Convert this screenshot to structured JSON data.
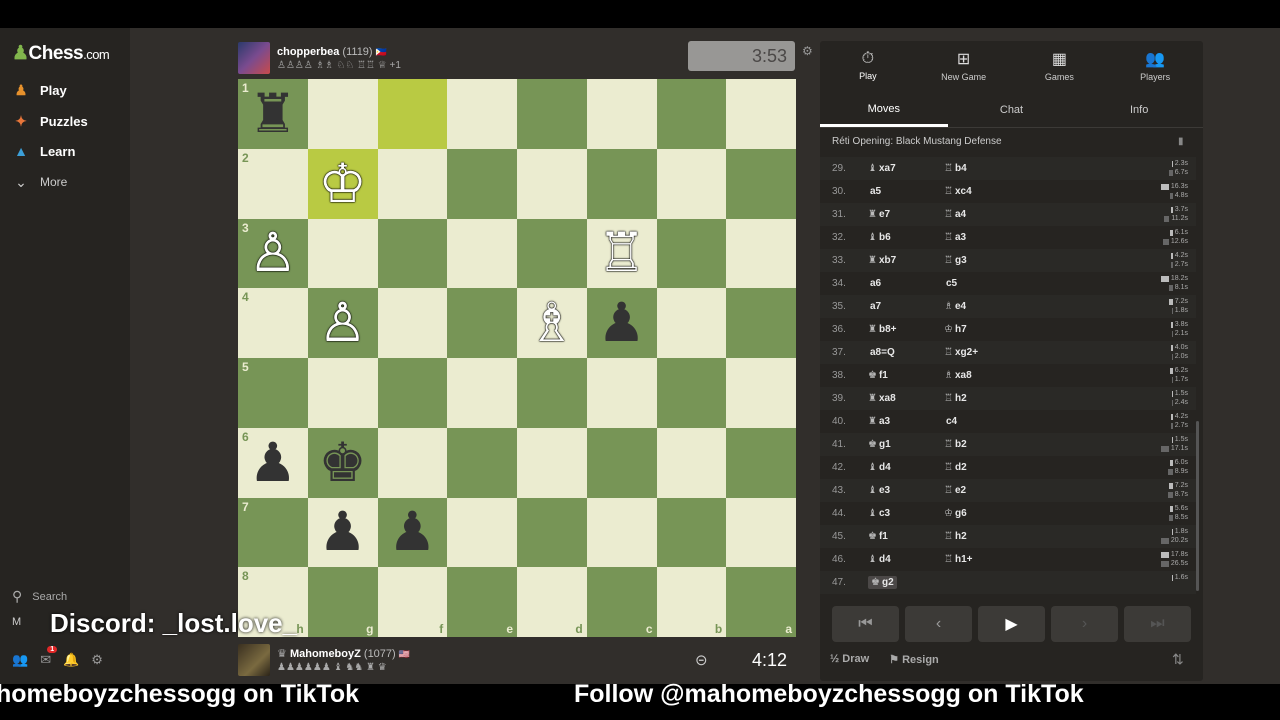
{
  "sidebar": {
    "logo": "Chess",
    "logo_suffix": ".com",
    "items": [
      {
        "label": "Play",
        "icon": "play-pawn-icon"
      },
      {
        "label": "Puzzles",
        "icon": "puzzle-icon"
      },
      {
        "label": "Learn",
        "icon": "learn-cap-icon"
      },
      {
        "label": "More",
        "icon": "chevron-down-icon"
      }
    ],
    "search_label": "Search",
    "user_label": "M",
    "notification_count": "1"
  },
  "top_player": {
    "name": "chopperbea",
    "rating": "(1119)",
    "captured": "♙♙♙♙ ♗♗ ♘♘ ♖♖ ♕",
    "advantage": "+1",
    "clock": "3:53"
  },
  "bottom_player": {
    "name": "MahomeboyZ",
    "rating": "(1077)",
    "captured": "♟♟♟♟♟♟ ♝ ♞♞ ♜ ♛",
    "clock": "4:12"
  },
  "board": {
    "ranks": [
      "1",
      "2",
      "3",
      "4",
      "5",
      "6",
      "7",
      "8"
    ],
    "files": [
      "h",
      "g",
      "f",
      "e",
      "d",
      "c",
      "b",
      "a"
    ],
    "pieces": [
      {
        "sq": "h1",
        "glyph": "♜",
        "color": "b"
      },
      {
        "sq": "g2",
        "glyph": "♔",
        "color": "w"
      },
      {
        "sq": "h3",
        "glyph": "♙",
        "color": "w"
      },
      {
        "sq": "c3",
        "glyph": "♖",
        "color": "w"
      },
      {
        "sq": "g4",
        "glyph": "♙",
        "color": "w"
      },
      {
        "sq": "d4",
        "glyph": "♗",
        "color": "w"
      },
      {
        "sq": "c4",
        "glyph": "♟",
        "color": "b"
      },
      {
        "sq": "h6",
        "glyph": "♟",
        "color": "b"
      },
      {
        "sq": "g6",
        "glyph": "♚",
        "color": "b"
      },
      {
        "sq": "g7",
        "glyph": "♟",
        "color": "b"
      },
      {
        "sq": "f7",
        "glyph": "♟",
        "color": "b"
      }
    ],
    "highlight": [
      "f1",
      "g2"
    ],
    "light_color": "#ebecd0",
    "dark_color": "#779556"
  },
  "panel": {
    "tabs": [
      {
        "label": "Play",
        "icon": "stopwatch-icon"
      },
      {
        "label": "New Game",
        "icon": "plus-icon"
      },
      {
        "label": "Games",
        "icon": "board-grid-icon"
      },
      {
        "label": "Players",
        "icon": "players-icon"
      }
    ],
    "subtabs": [
      "Moves",
      "Chat",
      "Info"
    ],
    "opening": "Réti Opening: Black Mustang Defense",
    "moves": [
      {
        "n": "29.",
        "w": "xa7",
        "wp": "♝",
        "b": "b4",
        "bp": "♖",
        "tw": "2.3s",
        "tb": "6.7s"
      },
      {
        "n": "30.",
        "w": "a5",
        "wp": "",
        "b": "xc4",
        "bp": "♖",
        "tw": "16.3s",
        "tb": "4.8s"
      },
      {
        "n": "31.",
        "w": "e7",
        "wp": "♜",
        "b": "a4",
        "bp": "♖",
        "tw": "3.7s",
        "tb": "11.2s"
      },
      {
        "n": "32.",
        "w": "b6",
        "wp": "♝",
        "b": "a3",
        "bp": "♖",
        "tw": "6.1s",
        "tb": "12.6s"
      },
      {
        "n": "33.",
        "w": "xb7",
        "wp": "♜",
        "b": "g3",
        "bp": "♖",
        "tw": "4.2s",
        "tb": "2.7s"
      },
      {
        "n": "34.",
        "w": "a6",
        "wp": "",
        "b": "c5",
        "bp": "",
        "tw": "18.2s",
        "tb": "8.1s"
      },
      {
        "n": "35.",
        "w": "a7",
        "wp": "",
        "b": "e4",
        "bp": "♗",
        "tw": "7.2s",
        "tb": "1.8s"
      },
      {
        "n": "36.",
        "w": "b8+",
        "wp": "♜",
        "b": "h7",
        "bp": "♔",
        "tw": "3.8s",
        "tb": "2.1s"
      },
      {
        "n": "37.",
        "w": "a8=Q",
        "wp": "",
        "b": "xg2+",
        "bp": "♖",
        "tw": "4.0s",
        "tb": "2.0s"
      },
      {
        "n": "38.",
        "w": "f1",
        "wp": "♚",
        "b": "xa8",
        "bp": "♗",
        "tw": "6.2s",
        "tb": "1.7s"
      },
      {
        "n": "39.",
        "w": "xa8",
        "wp": "♜",
        "b": "h2",
        "bp": "♖",
        "tw": "1.5s",
        "tb": "2.4s"
      },
      {
        "n": "40.",
        "w": "a3",
        "wp": "♜",
        "b": "c4",
        "bp": "",
        "tw": "4.2s",
        "tb": "2.7s"
      },
      {
        "n": "41.",
        "w": "g1",
        "wp": "♚",
        "b": "b2",
        "bp": "♖",
        "tw": "1.5s",
        "tb": "17.1s"
      },
      {
        "n": "42.",
        "w": "d4",
        "wp": "♝",
        "b": "d2",
        "bp": "♖",
        "tw": "6.0s",
        "tb": "8.9s"
      },
      {
        "n": "43.",
        "w": "e3",
        "wp": "♝",
        "b": "e2",
        "bp": "♖",
        "tw": "7.2s",
        "tb": "8.7s"
      },
      {
        "n": "44.",
        "w": "c3",
        "wp": "♝",
        "b": "g6",
        "bp": "♔",
        "tw": "5.6s",
        "tb": "8.5s"
      },
      {
        "n": "45.",
        "w": "f1",
        "wp": "♚",
        "b": "h2",
        "bp": "♖",
        "tw": "1.8s",
        "tb": "20.2s"
      },
      {
        "n": "46.",
        "w": "d4",
        "wp": "♝",
        "b": "h1+",
        "bp": "♖",
        "tw": "17.8s",
        "tb": "26.5s"
      },
      {
        "n": "47.",
        "w": "g2",
        "wp": "♚",
        "b": "",
        "bp": "",
        "tw": "1.6s",
        "tb": ""
      }
    ],
    "draw_label": "Draw",
    "draw_prefix": "½",
    "resign_label": "Resign"
  },
  "overlay": {
    "discord": "Discord: _lost.love_",
    "tiktok_left": "homeboyzchessogg on TikTok",
    "tiktok_right": "Follow @mahomeboyzchessogg on TikTok"
  }
}
